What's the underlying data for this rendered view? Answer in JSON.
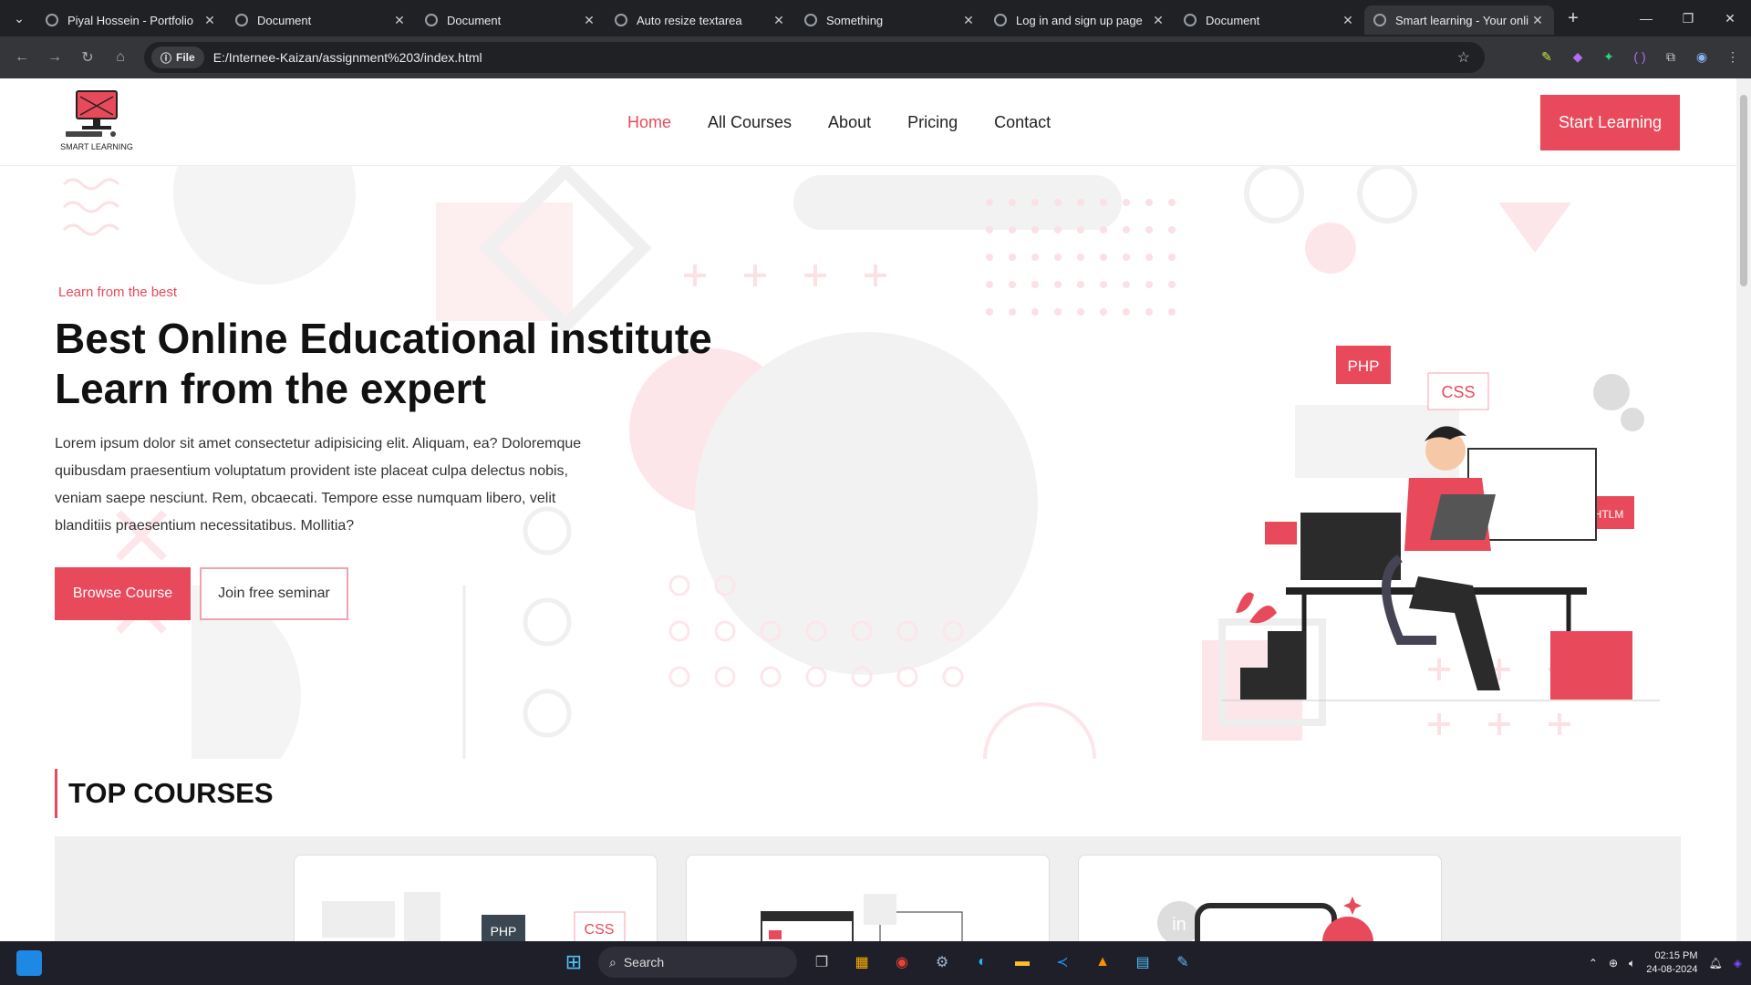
{
  "browser": {
    "tabs": [
      {
        "label": "Piyal Hossein - Portfolio",
        "active": false
      },
      {
        "label": "Document",
        "active": false
      },
      {
        "label": "Document",
        "active": false
      },
      {
        "label": "Auto resize textarea",
        "active": false
      },
      {
        "label": "Something",
        "active": false
      },
      {
        "label": "Log in and sign up page",
        "active": false
      },
      {
        "label": "Document",
        "active": false
      },
      {
        "label": "Smart learning - Your onli",
        "active": true
      }
    ],
    "file_chip": "File",
    "url": "E:/Internee-Kaizan/assignment%203/index.html"
  },
  "site": {
    "logo_text": "SMART LEARNING",
    "nav": [
      {
        "label": "Home",
        "active": true
      },
      {
        "label": "All Courses",
        "active": false
      },
      {
        "label": "About",
        "active": false
      },
      {
        "label": "Pricing",
        "active": false
      },
      {
        "label": "Contact",
        "active": false
      }
    ],
    "cta_top": "Start Learning",
    "hero": {
      "kicker": "Learn from the best",
      "headline_line1": "Best Online Educational institute",
      "headline_line2": "Learn from the expert",
      "lead": "Lorem ipsum dolor sit amet consectetur adipisicing elit. Aliquam, ea? Doloremque quibusdam praesentium voluptatum provident iste placeat culpa delectus nobis, veniam saepe nesciunt. Rem, obcaecati. Tempore esse numquam libero, velit blanditiis praesentium necessitatibus. Mollitia?",
      "btn_primary": "Browse Course",
      "btn_secondary": "Join free seminar",
      "illus_tags": {
        "php": "PHP",
        "css": "CSS",
        "html": "HTLM"
      }
    },
    "section_title": "TOP COURSES",
    "course_tags": {
      "php": "PHP",
      "css": "CSS"
    }
  },
  "taskbar": {
    "search": "Search",
    "time": "02:15 PM",
    "date": "24-08-2024"
  },
  "colors": {
    "accent": "#e8495b",
    "chrome_dark": "#202124"
  }
}
